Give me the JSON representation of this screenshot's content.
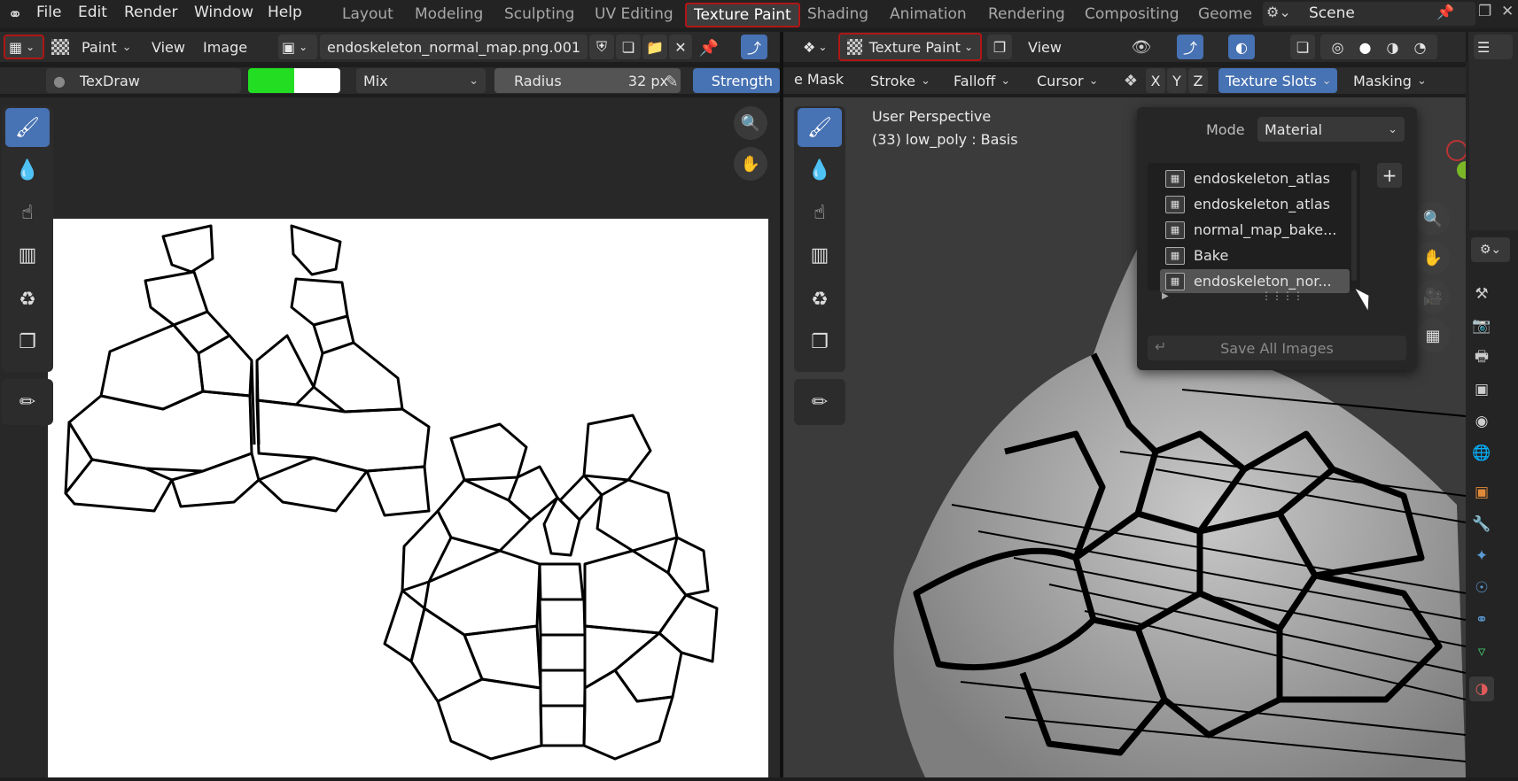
{
  "menu": [
    "File",
    "Edit",
    "Render",
    "Window",
    "Help"
  ],
  "workspaces": [
    "Layout",
    "Modeling",
    "Sculpting",
    "UV Editing",
    "Texture Paint",
    "Shading",
    "Animation",
    "Rendering",
    "Compositing",
    "Geome"
  ],
  "scene_name": "Scene",
  "image_editor": {
    "mode": "Paint",
    "view": "View",
    "image_menu": "Image",
    "image_name": "endoskeleton_normal_map.png.001"
  },
  "tool_settings": {
    "brush": "TexDraw",
    "blend": "Mix",
    "radius_label": "Radius",
    "radius_value": "32 px",
    "strength_label": "Strength",
    "color_primary": "#22dd22",
    "color_secondary": "#ffffff"
  },
  "viewport": {
    "mode": "Texture Paint",
    "view": "View",
    "perspective": "User Perspective",
    "object_info": "(33) low_poly : Basis",
    "menus": [
      "e Mask",
      "Stroke",
      "Falloff",
      "Cursor"
    ],
    "axes": [
      "X",
      "Y",
      "Z"
    ],
    "texture_slots": "Texture Slots",
    "masking": "Masking"
  },
  "texture_slots_popup": {
    "mode_label": "Mode",
    "mode_value": "Material",
    "slots": [
      "endoskeleton_atlas",
      "endoskeleton_atlas",
      "normal_map_bake...",
      "Bake",
      "endoskeleton_nor..."
    ],
    "selected_index": 4,
    "save_all": "Save All Images"
  },
  "colors": {
    "accent": "#4772b3",
    "highlight": "#b01616"
  }
}
